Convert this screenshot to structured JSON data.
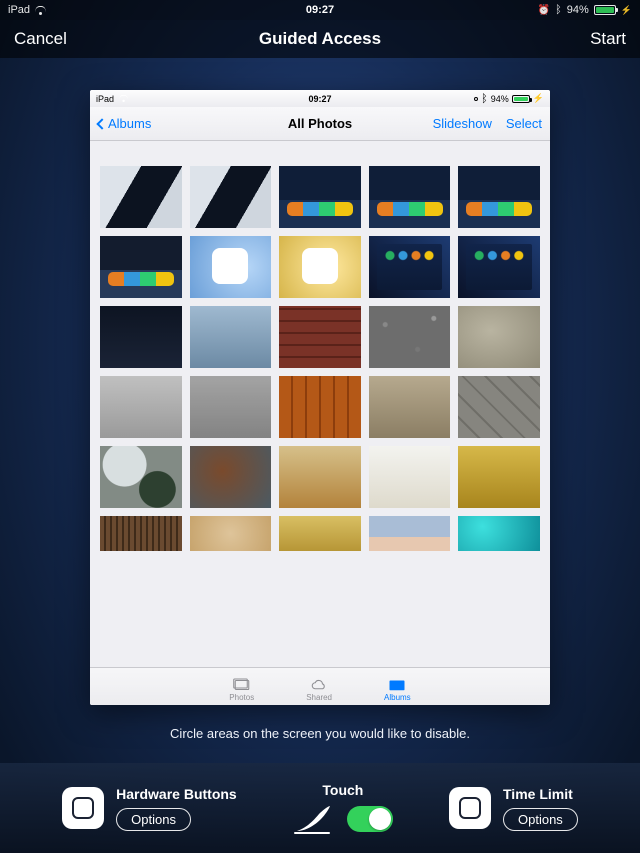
{
  "outer_status": {
    "device": "iPad",
    "time": "09:27",
    "battery_pct": "94%"
  },
  "outer_nav": {
    "cancel": "Cancel",
    "title": "Guided Access",
    "start": "Start"
  },
  "inner_status": {
    "device": "iPad",
    "time": "09:27",
    "battery_pct": "94%"
  },
  "inner_nav": {
    "back": "Albums",
    "title": "All Photos",
    "slideshow": "Slideshow",
    "select": "Select"
  },
  "tabs": {
    "photos": "Photos",
    "shared": "Shared",
    "albums": "Albums"
  },
  "instruction": "Circle areas on the screen you would like to disable.",
  "controls": {
    "hardware": {
      "title": "Hardware Buttons",
      "options": "Options"
    },
    "touch": {
      "title": "Touch",
      "on": true
    },
    "time": {
      "title": "Time Limit",
      "options": "Options"
    }
  }
}
